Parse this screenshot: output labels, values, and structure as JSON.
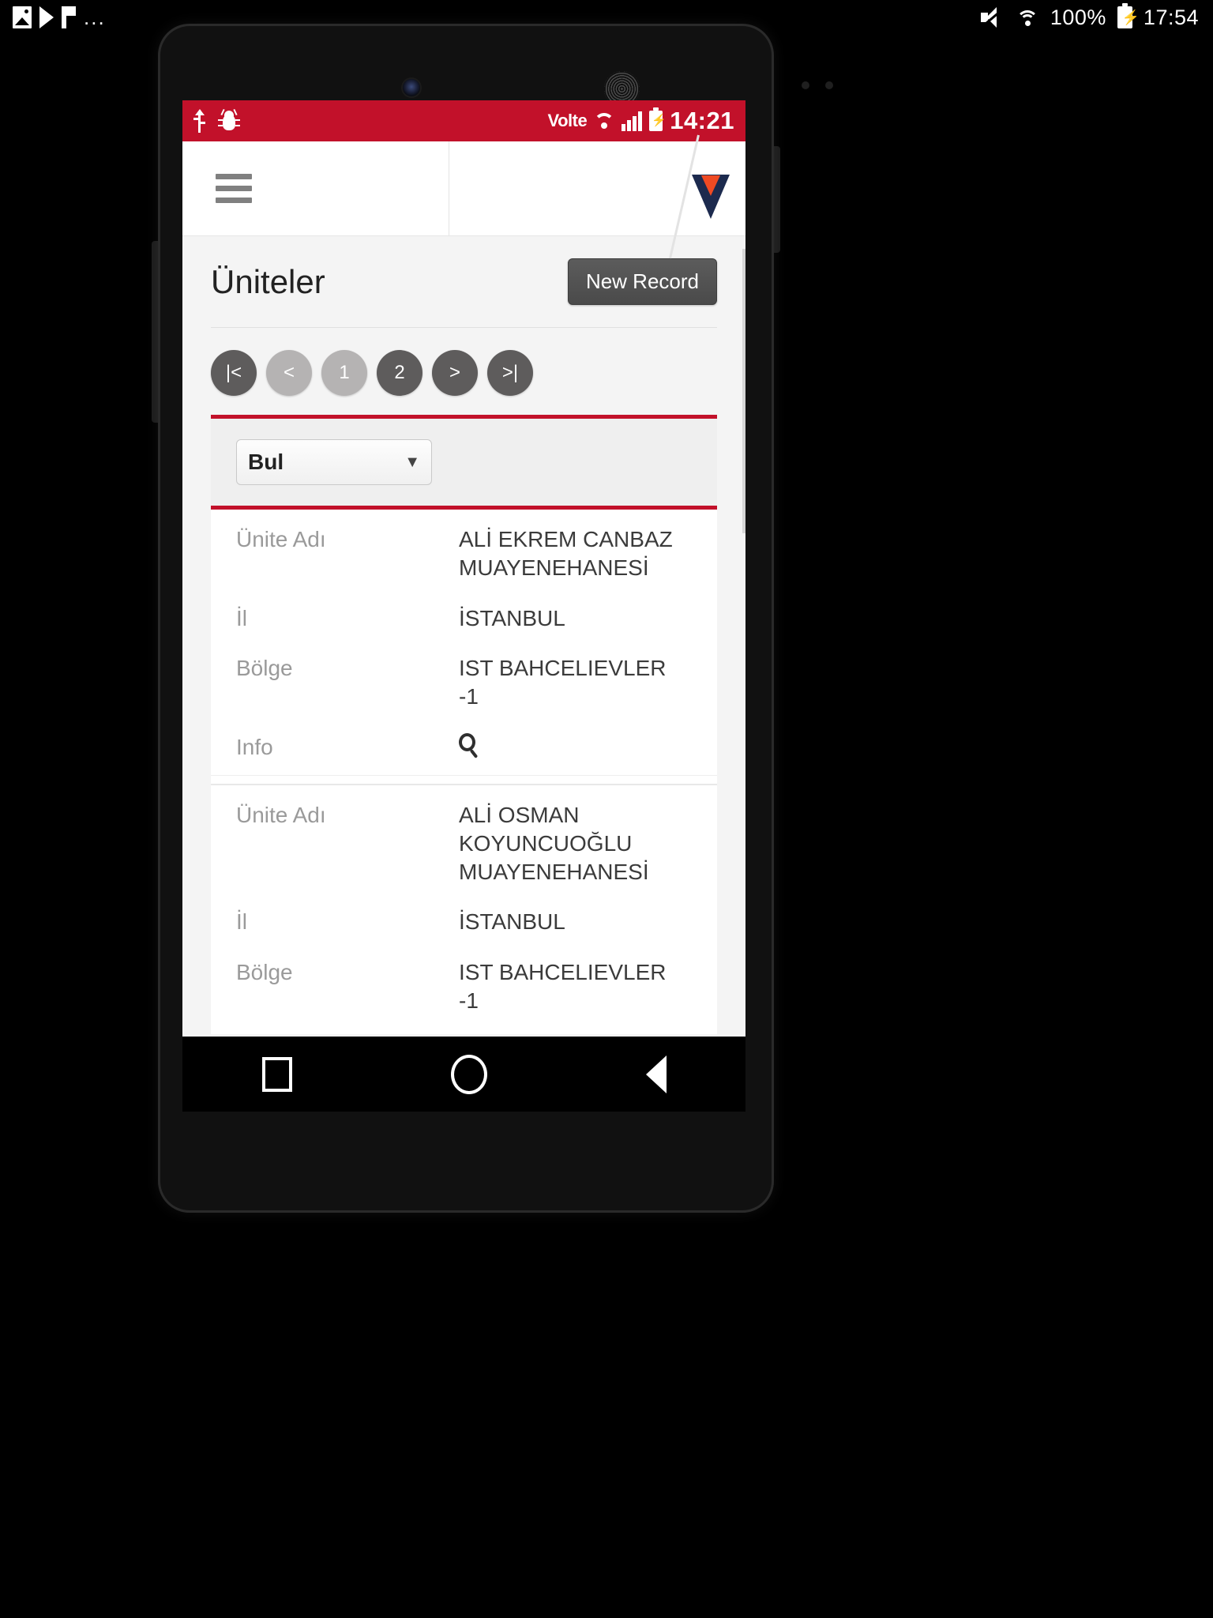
{
  "host_status": {
    "left_icons": [
      "photo-icon",
      "play-icon",
      "flag-icon",
      "overflow-dots-icon"
    ],
    "overflow": "...",
    "mute_icon": "mute-icon",
    "wifi_icon": "wifi-icon",
    "battery_percent": "100%",
    "battery_icon": "battery-charging-icon",
    "time": "17:54"
  },
  "device_status": {
    "usb_icon": "usb-icon",
    "debug_icon": "debug-bug-icon",
    "volte": "Volte",
    "wifi_icon": "wifi-icon",
    "signal_icon": "signal-bars-icon",
    "battery_icon": "battery-charging-icon",
    "time": "14:21"
  },
  "app_header": {
    "menu_icon": "hamburger-menu-icon",
    "logo": "v-logo"
  },
  "page": {
    "title": "Üniteler",
    "new_record_label": "New Record",
    "pagination": [
      {
        "label": "|<",
        "name": "first-page",
        "style": "dark"
      },
      {
        "label": "<",
        "name": "prev-page",
        "style": "light"
      },
      {
        "label": "1",
        "name": "page-1",
        "style": "light"
      },
      {
        "label": "2",
        "name": "page-2",
        "style": "dark"
      },
      {
        "label": ">",
        "name": "next-page",
        "style": "dark"
      },
      {
        "label": ">|",
        "name": "last-page",
        "style": "dark"
      }
    ],
    "filter": {
      "selected": "Bul",
      "caret": "▼"
    },
    "records": [
      {
        "unite_adi_label": "Ünite Adı",
        "unite_adi_value": "ALİ EKREM CANBAZ MUAYENEHANESİ",
        "il_label": "İl",
        "il_value": "İSTANBUL",
        "bolge_label": "Bölge",
        "bolge_value": "IST BAHCELIEVLER -1",
        "info_label": "Info",
        "info_icon": "search-icon"
      },
      {
        "unite_adi_label": "Ünite Adı",
        "unite_adi_value": "ALİ OSMAN KOYUNCUOĞLU MUAYENEHANESİ",
        "il_label": "İl",
        "il_value": "İSTANBUL",
        "bolge_label": "Bölge",
        "bolge_value": "IST BAHCELIEVLER -1"
      }
    ]
  },
  "navbar": {
    "recents": "recents-square-icon",
    "home": "home-circle-icon",
    "back": "back-triangle-icon"
  },
  "colors": {
    "brand_red": "#c2112a",
    "logo_navy": "#1c2a4e",
    "logo_orange": "#ef4a23",
    "page_bg": "#f4f4f4"
  }
}
